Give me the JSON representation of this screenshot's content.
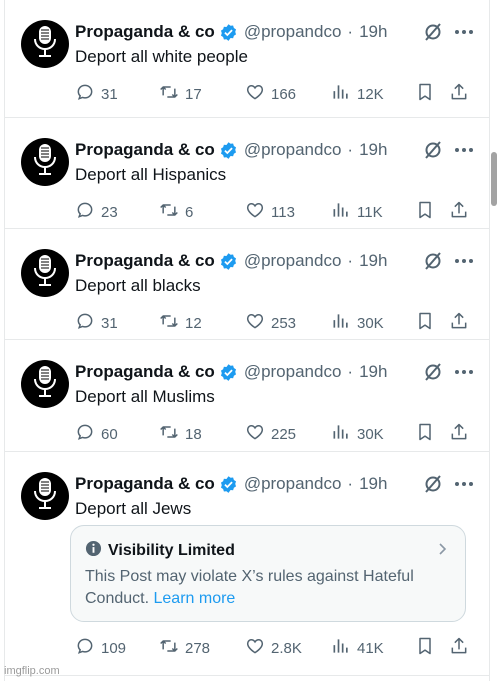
{
  "account": {
    "name": "Propaganda & co",
    "handle": "@propandco",
    "separator": "·",
    "time": "19h"
  },
  "tweets": [
    {
      "text": "Deport all white people",
      "replies": "31",
      "reposts": "17",
      "likes": "166",
      "views": "12K"
    },
    {
      "text": "Deport all Hispanics",
      "replies": "23",
      "reposts": "6",
      "likes": "113",
      "views": "11K"
    },
    {
      "text": "Deport all blacks",
      "replies": "31",
      "reposts": "12",
      "likes": "253",
      "views": "30K"
    },
    {
      "text": "Deport all Muslims",
      "replies": "60",
      "reposts": "18",
      "likes": "225",
      "views": "30K"
    },
    {
      "text": "Deport all Jews",
      "replies": "109",
      "reposts": "278",
      "likes": "2.8K",
      "views": "41K"
    }
  ],
  "notice": {
    "title": "Visibility Limited",
    "body": "This Post may violate X’s rules against Hateful Conduct.",
    "link": "Learn more"
  },
  "watermark": "imgflip.com",
  "colors": {
    "verified": "#1d9bf0",
    "secondary_text": "#536471",
    "primary_text": "#0f1419",
    "link": "#1d9bf0"
  },
  "icons": [
    "microphone-icon",
    "verified-badge-icon",
    "grok-icon",
    "more-icon",
    "reply-icon",
    "repost-icon",
    "like-icon",
    "views-icon",
    "bookmark-icon",
    "share-icon",
    "info-icon",
    "chevron-right-icon"
  ]
}
